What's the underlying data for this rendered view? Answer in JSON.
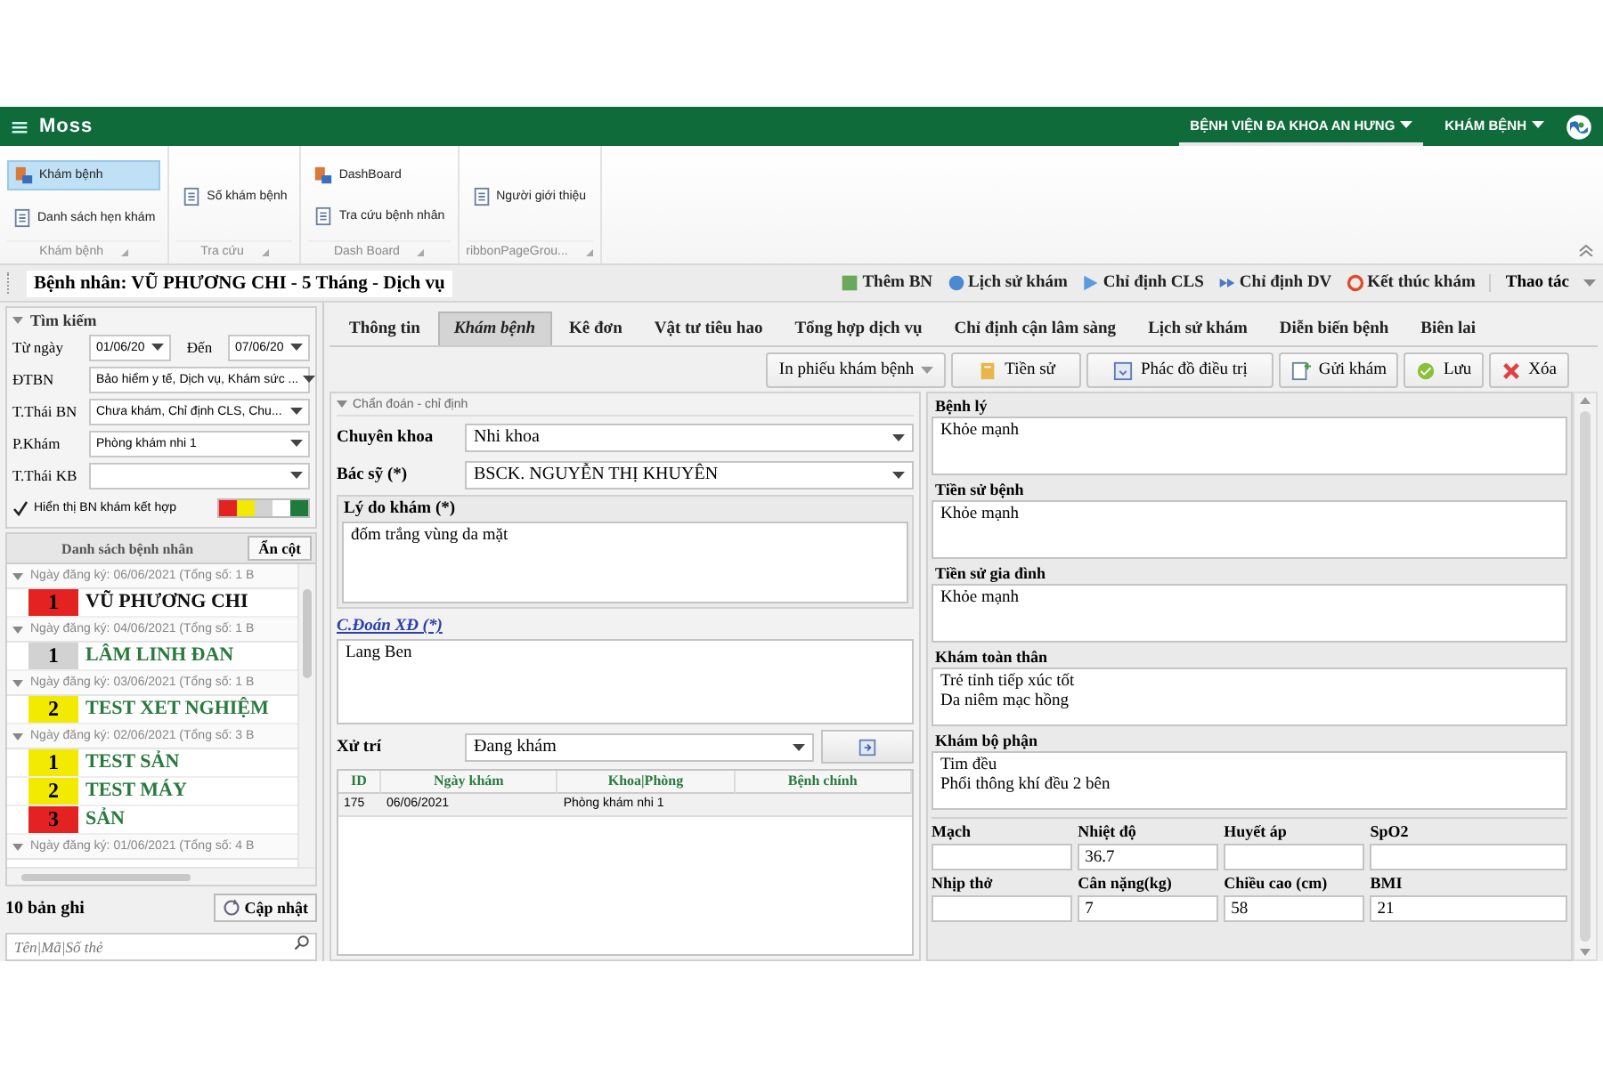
{
  "top_bar": {
    "logo": "Moss",
    "menus": [
      {
        "label": "BỆNH VIỆN ĐA KHOA AN HƯNG",
        "selected": true
      },
      {
        "label": "KHÁM BỆNH",
        "selected": false
      }
    ]
  },
  "ribbon": {
    "groups": [
      {
        "caption": "Khám bệnh",
        "items": [
          {
            "label": "Khám bệnh",
            "selected": true
          },
          {
            "label": "Danh sách hẹn khám",
            "selected": false
          }
        ]
      },
      {
        "caption": "Tra cứu",
        "items": [
          {
            "label": "Số khám bệnh",
            "selected": false
          }
        ]
      },
      {
        "caption": "Dash Board",
        "items": [
          {
            "label": "DashBoard",
            "selected": false
          },
          {
            "label": "Tra cứu bệnh nhân",
            "selected": false
          }
        ]
      },
      {
        "caption": "ribbonPageGrou...",
        "items": [
          {
            "label": "Người giới thiệu",
            "selected": false
          }
        ]
      }
    ]
  },
  "patient_bar": {
    "title": "Bệnh nhân: VŨ PHƯƠNG CHI - 5 Tháng - Dịch vụ",
    "actions": [
      "Thêm BN",
      "Lịch sử khám",
      "Chỉ định CLS",
      "Chỉ định DV",
      "Kết thúc khám"
    ],
    "menu": "Thao tác"
  },
  "search_panel": {
    "title": "Tìm kiếm",
    "expanded": true,
    "from_label": "Từ ngày",
    "from": "01/06/20",
    "to_label": "Đến",
    "to": "07/06/20",
    "filters": [
      {
        "label": "ĐTBN",
        "value": "Bảo hiểm y tế, Dịch vụ, Khám sức ..."
      },
      {
        "label": "T.Thái BN",
        "value": "Chưa khám, Chỉ định CLS, Chu..."
      },
      {
        "label": "P.Khám",
        "value": "Phòng khám nhi 1"
      },
      {
        "label": "T.Thái KB"
      }
    ],
    "combined": {
      "label": "Hiển thị BN khám kết hợp",
      "checked": true
    },
    "legend": [
      {
        "color": "#e52222"
      },
      {
        "color": "#f2ea00"
      },
      {
        "color": "#d2d2d2"
      },
      {
        "color": "#ffffff"
      },
      {
        "color": "#1f7a3c"
      }
    ]
  },
  "patient_list": {
    "title": "Danh sách bệnh nhân",
    "hide_button": "Ẩn cột",
    "groups": [
      {
        "header": "Ngày đăng ký: 06/06/2021 (Tổng số: 1 B",
        "expanded": true,
        "patients": [
          {
            "number": "1",
            "name": "VŨ PHƯƠNG CHI",
            "color": "#e52222",
            "selected": true
          }
        ]
      },
      {
        "header": "Ngày đăng ký: 04/06/2021 (Tổng số: 1 B",
        "expanded": true,
        "patients": [
          {
            "number": "1",
            "name": "LÂM LINH ĐAN",
            "color": "#d2d2d2",
            "selected": false
          }
        ]
      },
      {
        "header": "Ngày đăng ký: 03/06/2021 (Tổng số: 1 B",
        "expanded": true,
        "patients": [
          {
            "number": "2",
            "name": "TEST XET NGHIỆM",
            "color": "#f2ea00",
            "selected": false
          }
        ]
      },
      {
        "header": "Ngày đăng ký: 02/06/2021 (Tổng số: 3 B",
        "expanded": true,
        "patients": [
          {
            "number": "1",
            "name": "TEST SẢN",
            "color": "#f2ea00",
            "selected": false
          },
          {
            "number": "2",
            "name": "TEST MÁY",
            "color": "#f2ea00",
            "selected": false
          },
          {
            "number": "3",
            "name": "SẢN",
            "color": "#e52222",
            "selected": false
          }
        ]
      },
      {
        "header": "Ngày đăng ký: 01/06/2021 (Tổng số: 4 B",
        "expanded": true
      }
    ],
    "count": "10 bản ghi",
    "refresh_button": "Cập nhật",
    "search": {
      "placeholder": "Tên|Mã|Số thẻ"
    }
  },
  "tabs": [
    {
      "label": "Thông tin",
      "selected": false
    },
    {
      "label": "Khám bệnh",
      "selected": true
    },
    {
      "label": "Kê đơn",
      "selected": false
    },
    {
      "label": "Vật tư tiêu hao",
      "selected": false
    },
    {
      "label": "Tổng hợp dịch vụ",
      "selected": false
    },
    {
      "label": "Chỉ định cận lâm sàng",
      "selected": false
    },
    {
      "label": "Lịch sử khám",
      "selected": false
    },
    {
      "label": "Diễn biến bệnh",
      "selected": false
    },
    {
      "label": "Biên lai",
      "selected": false
    }
  ],
  "toolbar": {
    "print_button": "In phiếu khám bệnh",
    "buttons": [
      "Tiền sử",
      "Phác đồ điều trị",
      "Gửi khám",
      "Lưu",
      "Xóa"
    ]
  },
  "diagnosis": {
    "title": "Chẩn đoán - chỉ định",
    "specialty_label": "Chuyên khoa",
    "specialty": "Nhi khoa",
    "doctor_label": "Bác sỹ (*)",
    "doctor": "BSCK. NGUYỄN THỊ KHUYÊN",
    "reason_label": "Lý do khám (*)",
    "reason": "đốm trắng vùng da mặt",
    "final_label": "C.Đoán XĐ (*)",
    "final": "Lang Ben",
    "treatment_label": "Xử trí",
    "treatment": "Đang khám"
  },
  "visits": {
    "columns": [
      "ID",
      "Ngày khám",
      "Khoa|Phòng",
      "Bệnh chính"
    ],
    "rows": [
      [
        "175",
        "06/06/2021",
        "Phòng khám nhi 1"
      ]
    ]
  },
  "exam_notes": [
    {
      "label": "Bệnh lý",
      "value": "Khỏe mạnh"
    },
    {
      "label": "Tiền sử bệnh",
      "value": "Khỏe mạnh"
    },
    {
      "label": "Tiền sử gia đình",
      "value": "Khỏe mạnh"
    },
    {
      "label": "Khám toàn thân",
      "value": "Trẻ tỉnh tiếp xúc tốt\nDa niêm mạc hồng"
    },
    {
      "label": "Khám bộ phận",
      "value": "Tim đều\nPhổi thông khí đều 2 bên"
    }
  ],
  "vitals": [
    {
      "label": "Mạch"
    },
    {
      "label": "Nhiệt độ",
      "value": "36.7"
    },
    {
      "label": "Huyết áp"
    },
    {
      "label": "SpO2"
    },
    {
      "label": "Nhịp thở"
    },
    {
      "label": "Cân nặng(kg)",
      "value": "7"
    },
    {
      "label": "Chiều cao (cm)",
      "value": "58"
    },
    {
      "label": "BMI",
      "value": "21"
    }
  ]
}
